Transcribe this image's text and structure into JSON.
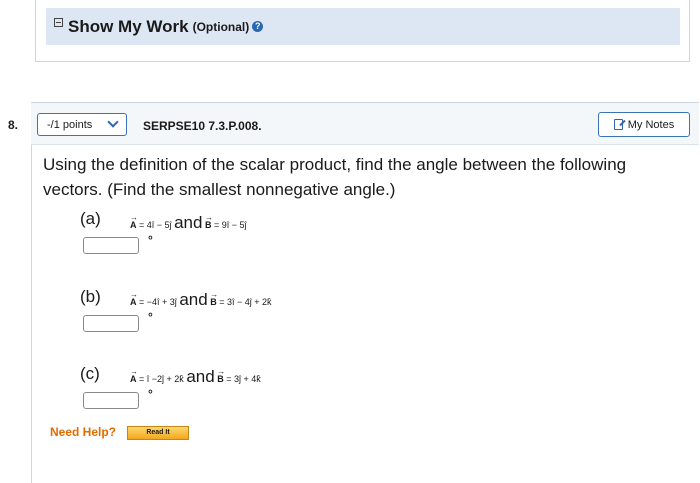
{
  "show_my_work": {
    "title": "Show My Work",
    "optional": "(Optional)",
    "help_glyph": "?"
  },
  "question": {
    "number": "8.",
    "points": "-/1 points",
    "code": "SERPSE10 7.3.P.008.",
    "notes_label": "My Notes",
    "prompt": "Using the definition of the scalar product, find the angle between the following vectors. (Find the smallest nonnegative angle.)",
    "parts": [
      {
        "label": "(a)",
        "a_expr": "= 4î − 5ĵ",
        "and": "and",
        "b_expr": "= 9î − 5ĵ",
        "unit": "°",
        "value": ""
      },
      {
        "label": "(b)",
        "a_expr": "= −4î + 3ĵ",
        "and": "and",
        "b_expr": "= 3î − 4ĵ + 2k̂",
        "unit": "°",
        "value": ""
      },
      {
        "label": "(c)",
        "a_expr": "= î −2ĵ + 2k̂",
        "and": "and",
        "b_expr": "= 3ĵ + 4k̂",
        "unit": "°",
        "value": ""
      }
    ],
    "vector_a": "A",
    "vector_b": "B",
    "need_help": "Need Help?",
    "read_it": "Read It"
  },
  "icons": {
    "collapse": "collapse-icon",
    "help": "help-icon",
    "chevron": "chevron-down-icon",
    "notes": "notes-icon"
  },
  "colors": {
    "accent_blue": "#2b67b0",
    "panel_bg": "#dde7f3",
    "need_help": "#e36b00",
    "read_it": "#f3a71f"
  }
}
